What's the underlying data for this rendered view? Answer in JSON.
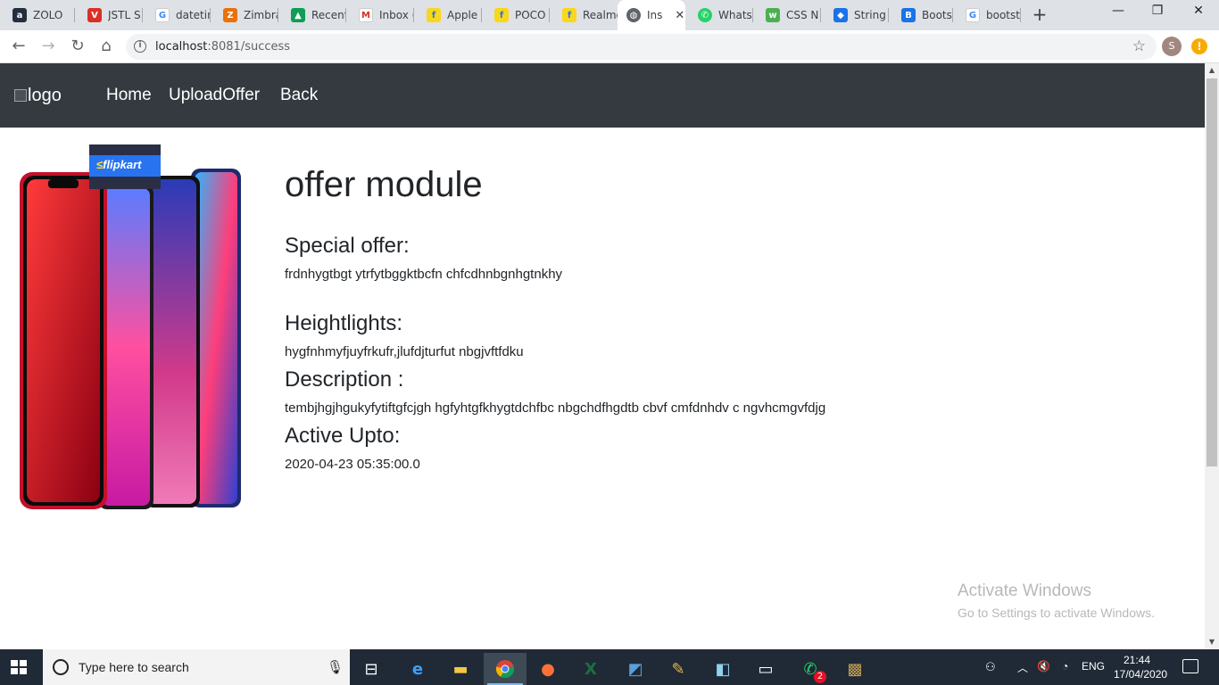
{
  "browser": {
    "tabs": [
      {
        "title": "ZOLO",
        "icon": "amazon-icon",
        "color": "#232f3e"
      },
      {
        "title": "JSTL S",
        "icon": "red-v-icon",
        "color": "#d93025"
      },
      {
        "title": "datetin",
        "icon": "google-icon",
        "color": "#4285f4"
      },
      {
        "title": "Zimbra",
        "icon": "zimbra-icon",
        "color": "#e8710a"
      },
      {
        "title": "Recent",
        "icon": "drive-icon",
        "color": "#0f9d58"
      },
      {
        "title": "Inbox (",
        "icon": "gmail-icon",
        "color": "#d93025"
      },
      {
        "title": "Apple",
        "icon": "flipkart-icon",
        "color": "#f9d71c"
      },
      {
        "title": "POCO",
        "icon": "flipkart-icon",
        "color": "#f9d71c"
      },
      {
        "title": "Realme",
        "icon": "flipkart-icon",
        "color": "#f9d71c"
      },
      {
        "title": "Ins",
        "icon": "globe-icon",
        "color": "#5f6368"
      },
      {
        "title": "Whats",
        "icon": "whatsapp-icon",
        "color": "#25d366"
      },
      {
        "title": "CSS N",
        "icon": "w3-icon",
        "color": "#4caf50"
      },
      {
        "title": "String",
        "icon": "mortarboard-icon",
        "color": "#1a73e8"
      },
      {
        "title": "Bootst",
        "icon": "bootstrap-icon",
        "color": "#1a73e8"
      },
      {
        "title": "bootst",
        "icon": "google-icon",
        "color": "#4285f4"
      }
    ],
    "url_host": "localhost",
    "url_rest": ":8081/success",
    "profile_initial": "S",
    "update_badge": "!"
  },
  "site": {
    "logo_alt": "logo",
    "nav": {
      "home": "Home",
      "upload": "UploadOffer",
      "back": "Back"
    }
  },
  "offer": {
    "title": "offer module",
    "special_label": "Special offer:",
    "special_value": "frdnhygtbgt ytrfytbggktbcfn chfcdhnbgnhgtnkhy",
    "highlights_label": "Heightlights:",
    "highlights_value": "hygfnhmyfjuyfrkufr,jlufdjturfut nbgjvftfdku",
    "description_label": "Description :",
    "description_value": "tembjhgjhgukyfytiftgfcjgh hgfyhtgfkhygtdchfbc nbgchdfhgdtb cbvf cmfdnhdv c ngvhcmgvfdjg",
    "active_label": "Active Upto:",
    "active_value": "2020-04-23 05:35:00.0",
    "banner_text": "flipkart"
  },
  "watermark": {
    "line1": "Activate Windows",
    "line2": "Go to Settings to activate Windows."
  },
  "taskbar": {
    "search_placeholder": "Type here to search",
    "whatsapp_badge": "2",
    "lang": "ENG",
    "time": "21:44",
    "date": "17/04/2020"
  }
}
